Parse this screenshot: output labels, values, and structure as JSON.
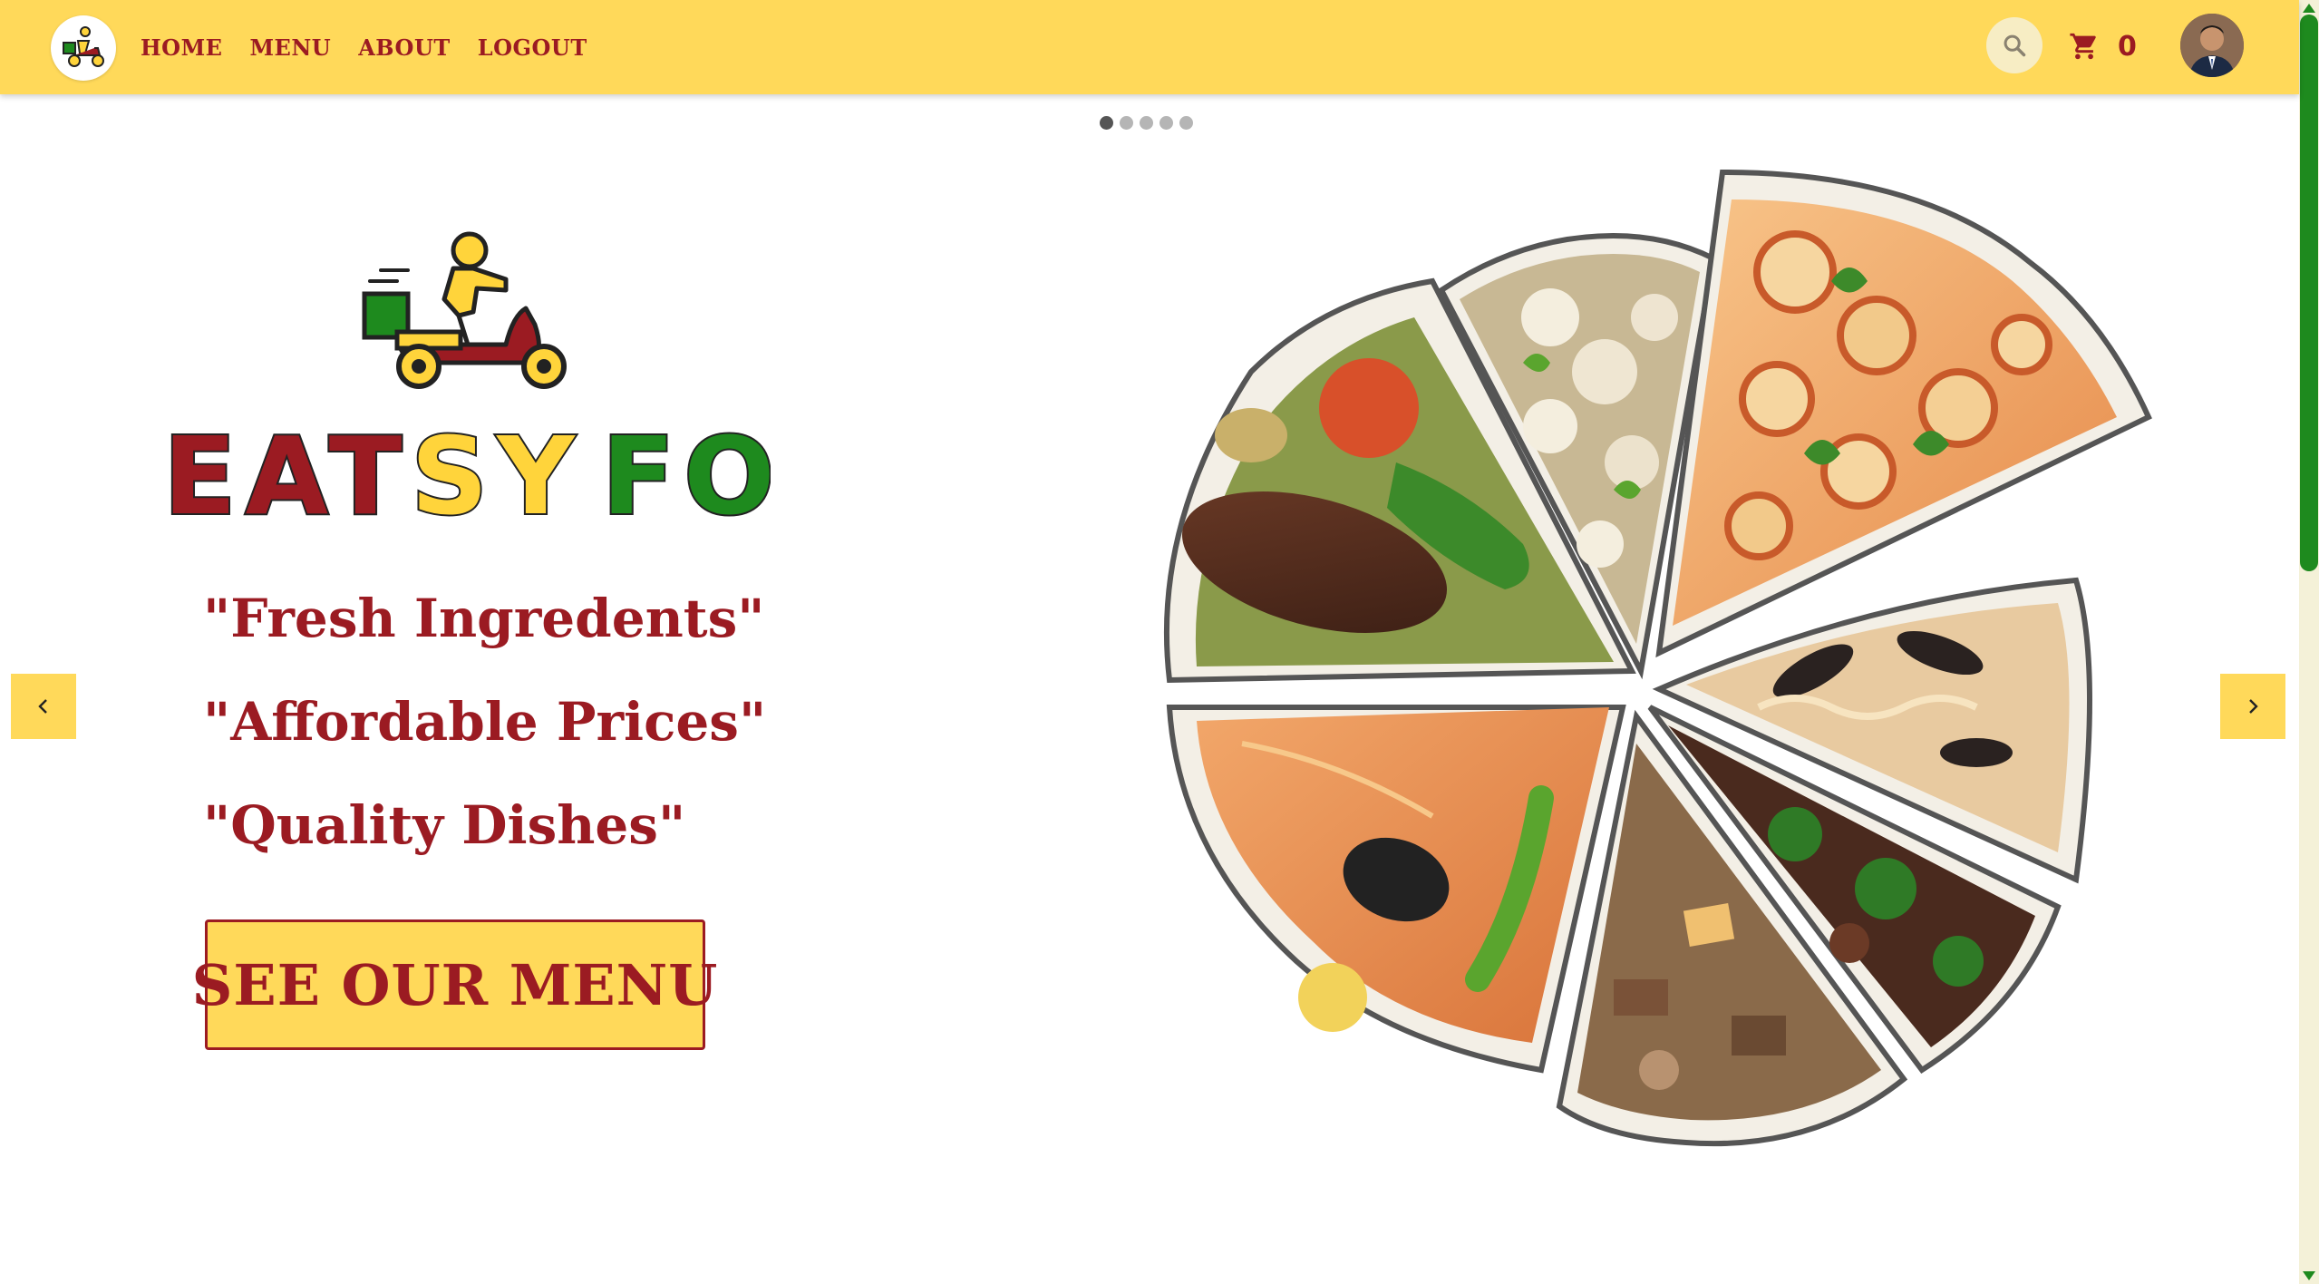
{
  "nav": {
    "logo_icon": "delivery-scooter-icon",
    "links": [
      {
        "label": "HOME"
      },
      {
        "label": "MENU"
      },
      {
        "label": "ABOUT"
      },
      {
        "label": "LOGOUT"
      }
    ],
    "search_icon": "search-icon",
    "cart_icon": "cart-icon",
    "cart_count": "0",
    "avatar_icon": "user-avatar"
  },
  "carousel": {
    "slide_count": 5,
    "active_index": 0,
    "prev_icon": "chevron-left-icon",
    "next_icon": "chevron-right-icon"
  },
  "hero": {
    "logo_text_1": "EAT",
    "logo_text_2": "SY",
    "logo_text_3": "FOOD",
    "taglines": [
      "\"Fresh Ingredents\"",
      "\"Affordable Prices\"",
      "\"Quality Dishes\""
    ],
    "cta_label": "SEE OUR MENU",
    "image": "food-slices-wheel"
  },
  "colors": {
    "primary_yellow": "#ffd95a",
    "brand_red": "#9b1b22",
    "brand_green": "#1e8a1e",
    "logo_yellow": "#ffd43b"
  }
}
